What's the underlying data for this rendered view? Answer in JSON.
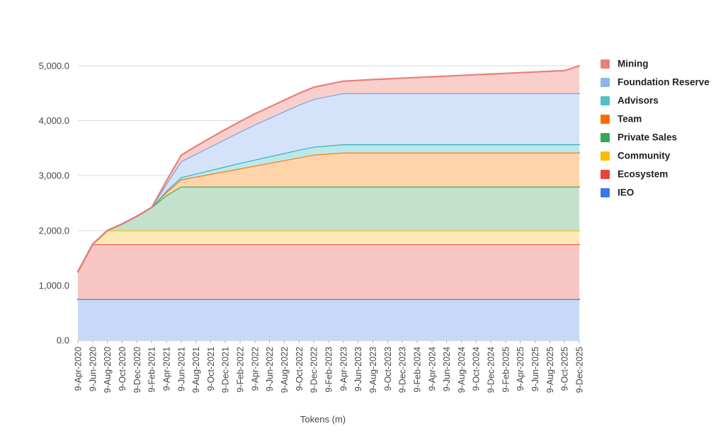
{
  "chart_data": {
    "type": "area",
    "stacked": true,
    "title": "",
    "xlabel": "Tokens (m)",
    "ylabel": "",
    "ylim": [
      0,
      5000
    ],
    "yticks": [
      0,
      1000,
      2000,
      3000,
      4000,
      5000
    ],
    "ytick_labels": [
      "0.0",
      "1,000.0",
      "2,000.0",
      "3,000.0",
      "4,000.0",
      "5,000.0"
    ],
    "grid": true,
    "legend_position": "right",
    "categories": [
      "9-Apr-2020",
      "9-Jun-2020",
      "9-Aug-2020",
      "9-Oct-2020",
      "9-Dec-2020",
      "9-Feb-2021",
      "9-Apr-2021",
      "9-Jun-2021",
      "9-Aug-2021",
      "9-Oct-2021",
      "9-Dec-2021",
      "9-Feb-2022",
      "9-Apr-2022",
      "9-Jun-2022",
      "9-Aug-2022",
      "9-Oct-2022",
      "9-Dec-2022",
      "9-Feb-2023",
      "9-Apr-2023",
      "9-Jun-2023",
      "9-Aug-2023",
      "9-Oct-2023",
      "9-Dec-2023",
      "9-Feb-2024",
      "9-Apr-2024",
      "9-Jun-2024",
      "9-Aug-2024",
      "9-Oct-2024",
      "9-Dec-2024",
      "9-Feb-2025",
      "9-Apr-2025",
      "9-Jun-2025",
      "9-Aug-2025",
      "9-Oct-2025",
      "9-Dec-2025"
    ],
    "series": [
      {
        "name": "IEO",
        "color": "#3b78e7",
        "fill": "#c6d9f7",
        "values": [
          750,
          750,
          750,
          750,
          750,
          750,
          750,
          750,
          750,
          750,
          750,
          750,
          750,
          750,
          750,
          750,
          750,
          750,
          750,
          750,
          750,
          750,
          750,
          750,
          750,
          750,
          750,
          750,
          750,
          750,
          750,
          750,
          750,
          750,
          750
        ]
      },
      {
        "name": "Ecosystem",
        "color": "#e8453c",
        "fill": "#f7c6c2",
        "values": [
          500,
          1000,
          1000,
          1000,
          1000,
          1000,
          1000,
          1000,
          1000,
          1000,
          1000,
          1000,
          1000,
          1000,
          1000,
          1000,
          1000,
          1000,
          1000,
          1000,
          1000,
          1000,
          1000,
          1000,
          1000,
          1000,
          1000,
          1000,
          1000,
          1000,
          1000,
          1000,
          1000,
          1000,
          1000
        ]
      },
      {
        "name": "Community",
        "color": "#fbbc04",
        "fill": "#fde9b5",
        "values": [
          0,
          0,
          250,
          250,
          250,
          250,
          250,
          250,
          250,
          250,
          250,
          250,
          250,
          250,
          250,
          250,
          250,
          250,
          250,
          250,
          250,
          250,
          250,
          250,
          250,
          250,
          250,
          250,
          250,
          250,
          250,
          250,
          250,
          250,
          250
        ]
      },
      {
        "name": "Private Sales",
        "color": "#34a853",
        "fill": "#c3e2cd",
        "values": [
          0,
          0,
          0,
          120,
          260,
          420,
          640,
          800,
          800,
          800,
          800,
          800,
          800,
          800,
          800,
          800,
          800,
          800,
          800,
          800,
          800,
          800,
          800,
          800,
          800,
          800,
          800,
          800,
          800,
          800,
          800,
          800,
          800,
          800,
          800
        ]
      },
      {
        "name": "Team",
        "color": "#ff6d01",
        "fill": "#ffd4ab",
        "values": [
          0,
          0,
          0,
          0,
          0,
          0,
          60,
          130,
          180,
          230,
          280,
          330,
          380,
          430,
          480,
          530,
          580,
          600,
          620,
          620,
          620,
          620,
          620,
          620,
          620,
          620,
          620,
          620,
          620,
          620,
          620,
          620,
          620,
          620,
          620
        ]
      },
      {
        "name": "Advisors",
        "color": "#22b1b6",
        "fill": "#bde8e8",
        "values": [
          0,
          0,
          0,
          0,
          0,
          0,
          20,
          40,
          55,
          70,
          85,
          100,
          110,
          120,
          130,
          140,
          145,
          148,
          150,
          150,
          150,
          150,
          150,
          150,
          150,
          150,
          150,
          150,
          150,
          150,
          150,
          150,
          150,
          150,
          150
        ]
      },
      {
        "name": "Foundation Reserve",
        "color": "#6d9eeb",
        "fill": "#d4e2fa",
        "values": [
          0,
          0,
          0,
          0,
          0,
          0,
          130,
          290,
          360,
          430,
          500,
          570,
          640,
          700,
          760,
          820,
          870,
          900,
          930,
          930,
          930,
          930,
          930,
          930,
          930,
          930,
          930,
          930,
          930,
          930,
          930,
          930,
          930,
          930,
          930
        ]
      },
      {
        "name": "Mining",
        "color": "#ec7f77",
        "fill": "#f8cfcb",
        "values": [
          0,
          0,
          0,
          0,
          0,
          0,
          50,
          110,
          140,
          160,
          175,
          185,
          195,
          200,
          205,
          210,
          215,
          218,
          220,
          235,
          250,
          262,
          275,
          288,
          300,
          312,
          325,
          338,
          350,
          362,
          375,
          388,
          400,
          412,
          500
        ]
      }
    ],
    "legend_entries": [
      {
        "label": "Mining",
        "color": "#ec7f77"
      },
      {
        "label": "Foundation Reserve",
        "color": "#8cb3f0"
      },
      {
        "label": "Advisors",
        "color": "#4ec3c6"
      },
      {
        "label": "Team",
        "color": "#ff6d01"
      },
      {
        "label": "Private Sales",
        "color": "#34a853"
      },
      {
        "label": "Community",
        "color": "#fbbc04"
      },
      {
        "label": "Ecosystem",
        "color": "#e8453c"
      },
      {
        "label": "IEO",
        "color": "#3b78e7"
      }
    ]
  }
}
